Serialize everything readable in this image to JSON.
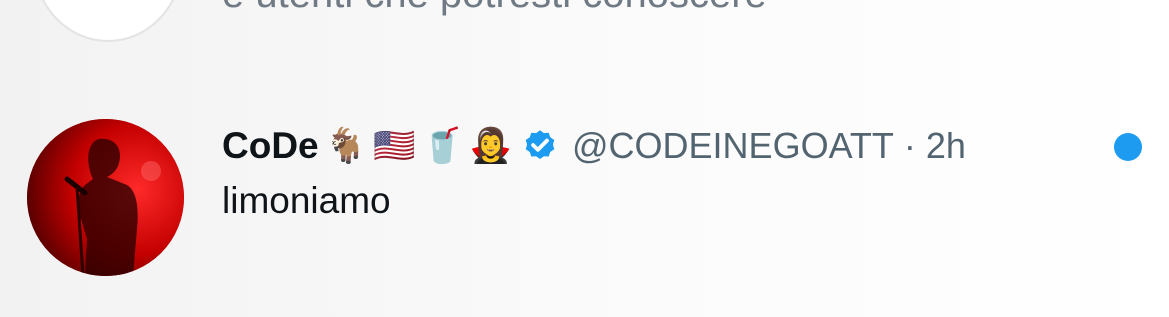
{
  "top_row": {
    "text": "e utenti che potresti conoscere"
  },
  "notification": {
    "display_name": "CoDe",
    "name_emojis": [
      "🐐",
      "🇺🇸",
      "🥤",
      "🧛‍♀️"
    ],
    "handle": "@CODEINEGOATT",
    "separator": "·",
    "time": "2h",
    "text": "limoniamo",
    "unread_color": "#1d9bf0",
    "verified_color": "#1d9bf0"
  }
}
